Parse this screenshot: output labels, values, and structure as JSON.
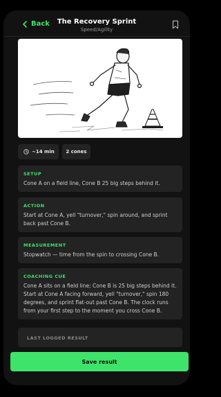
{
  "header": {
    "back_label": "Back",
    "title": "The Recovery Sprint",
    "subtitle": "Speed/Agility"
  },
  "chips": {
    "duration": "~14 min",
    "equipment": "2 cones"
  },
  "sections": {
    "setup": {
      "label": "SETUP",
      "text": "Cone A on a field line, Cone B 25 big steps behind it."
    },
    "action": {
      "label": "ACTION",
      "text": "Start at Cone A, yell \"turnover,\" spin around, and sprint back past Cone B."
    },
    "measurement": {
      "label": "MEASUREMENT",
      "text": "Stopwatch — time from the spin to crossing Cone B."
    },
    "coaching_cue": {
      "label": "COACHING CUE",
      "text": "Cone A sits on a field line; Cone B is 25 big steps behind it. Start at Cone A facing forward, yell \"turnover,\" spin 180 degrees, and sprint flat-out past Cone B. The clock runs from your first step to the moment you cross Cone B."
    },
    "last_result": {
      "label": "LAST LOGGED RESULT"
    }
  },
  "actions": {
    "save_label": "Save result"
  },
  "colors": {
    "accent": "#3ee36a",
    "background": "#121212",
    "card": "#232323"
  },
  "icons": {
    "back": "chevron-left-icon",
    "bookmark": "bookmark-icon",
    "duration": "clock-icon"
  }
}
